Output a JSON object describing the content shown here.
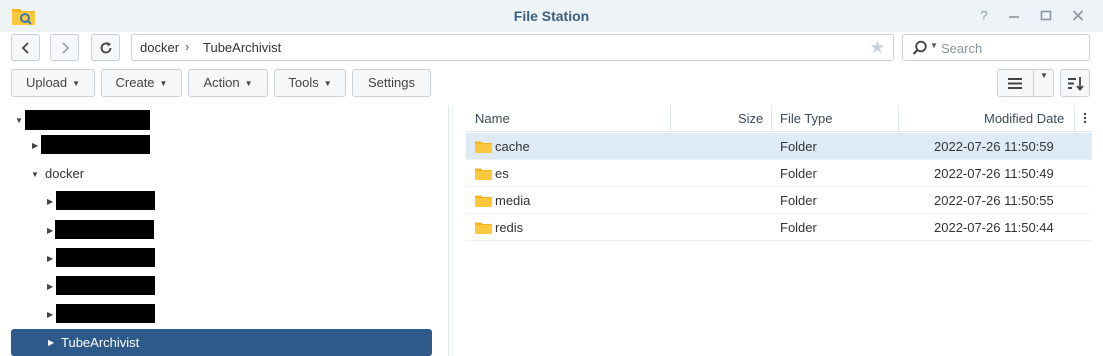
{
  "window": {
    "title": "File Station",
    "app_icon": "file-station-icon",
    "controls": {
      "help": "?",
      "minimize": "–",
      "maximize": "□",
      "close": "✕"
    }
  },
  "nav": {
    "back_icon": "chevron-left-icon",
    "forward_icon": "chevron-right-icon",
    "refresh_icon": "refresh-icon",
    "path": [
      "docker",
      "TubeArchivist"
    ],
    "path_separator": "›",
    "favorite_icon": "star-icon",
    "search_placeholder": "Search"
  },
  "toolbar": {
    "upload": "Upload",
    "create": "Create",
    "action": "Action",
    "tools": "Tools",
    "settings": "Settings",
    "view_icon": "list-view-icon",
    "sort_icon": "sort-icon"
  },
  "tree": {
    "docker_label": "docker",
    "selected_label": "TubeArchivist"
  },
  "grid": {
    "columns": {
      "name": "Name",
      "size": "Size",
      "type": "File Type",
      "modified": "Modified Date"
    },
    "rows": [
      {
        "name": "cache",
        "size": "",
        "type": "Folder",
        "modified": "2022-07-26 11:50:59",
        "selected": true
      },
      {
        "name": "es",
        "size": "",
        "type": "Folder",
        "modified": "2022-07-26 11:50:49",
        "selected": false
      },
      {
        "name": "media",
        "size": "",
        "type": "Folder",
        "modified": "2022-07-26 11:50:55",
        "selected": false
      },
      {
        "name": "redis",
        "size": "",
        "type": "Folder",
        "modified": "2022-07-26 11:50:44",
        "selected": false
      }
    ]
  },
  "colors": {
    "accent": "#2d5a8a",
    "titlebar": "#eef3f8",
    "row_selected": "#deebf7",
    "folder": "#f6b31a",
    "title_text": "#3a5f7f"
  }
}
